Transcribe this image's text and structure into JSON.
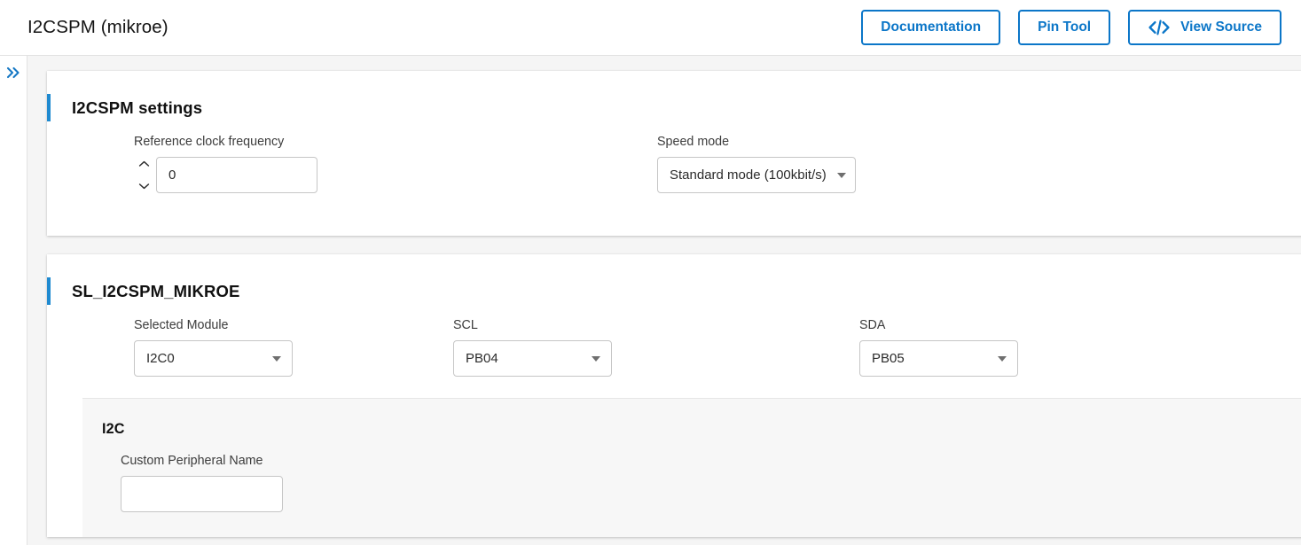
{
  "header": {
    "title": "I2CSPM (mikroe)",
    "buttons": [
      {
        "label": "Documentation",
        "icon": null
      },
      {
        "label": "Pin Tool",
        "icon": null
      },
      {
        "label": "View Source",
        "icon": "code-icon"
      }
    ]
  },
  "rail": {
    "toggle_icon": "double-chevron-right-icon"
  },
  "panels": [
    {
      "title": "I2CSPM settings",
      "accent_color": "#1f8ad0",
      "fields": [
        {
          "label": "Reference clock frequency",
          "type": "number",
          "value": "0",
          "placeholder": "",
          "spinner_up_icon": "chevron-up-icon",
          "spinner_down_icon": "chevron-down-icon"
        },
        {
          "label": "Speed mode",
          "type": "select",
          "value": "Standard mode (100kbit/s)",
          "caret_icon": "caret-down-icon"
        }
      ]
    },
    {
      "title": "SL_I2CSPM_MIKROE",
      "accent_color": "#1f8ad0",
      "fields": [
        {
          "label": "Selected Module",
          "type": "select",
          "value": "I2C0",
          "caret_icon": "caret-down-icon"
        },
        {
          "label": "SCL",
          "type": "select",
          "value": "PB04",
          "caret_icon": "caret-down-icon"
        },
        {
          "label": "SDA",
          "type": "select",
          "value": "PB05",
          "caret_icon": "caret-down-icon"
        }
      ],
      "subpanel": {
        "title": "I2C",
        "fields": [
          {
            "label": "Custom Peripheral Name",
            "type": "text",
            "value": "",
            "placeholder": ""
          }
        ]
      }
    }
  ]
}
